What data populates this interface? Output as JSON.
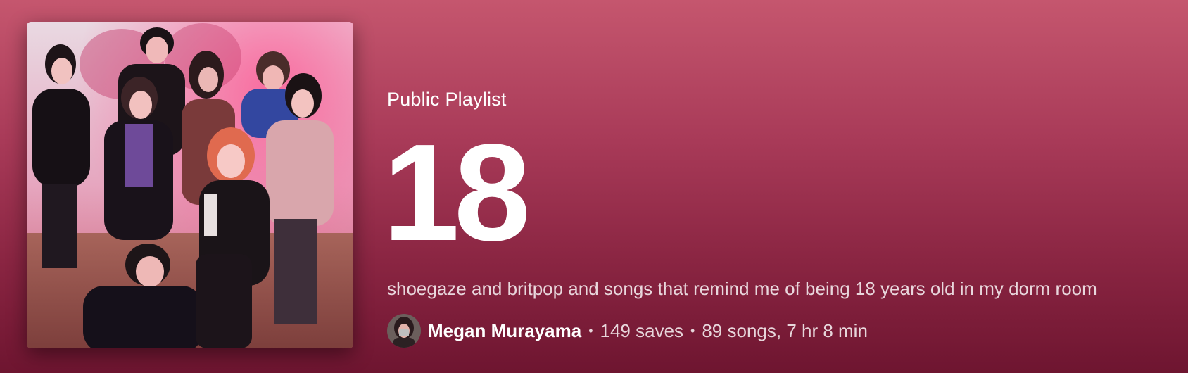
{
  "playlist": {
    "type_label": "Public Playlist",
    "title": "18",
    "description": "shoegaze and britpop and songs that remind me of being 18 years old in my dorm room",
    "owner": "Megan Murayama",
    "saves": "149 saves",
    "songs_duration": "89 songs, 7 hr 8 min",
    "separator": "•"
  },
  "icons": {
    "cover": "playlist-cover-photo",
    "avatar": "owner-avatar-photo"
  },
  "colors": {
    "header_top": "#c5566e",
    "header_bottom": "#6e1530"
  }
}
